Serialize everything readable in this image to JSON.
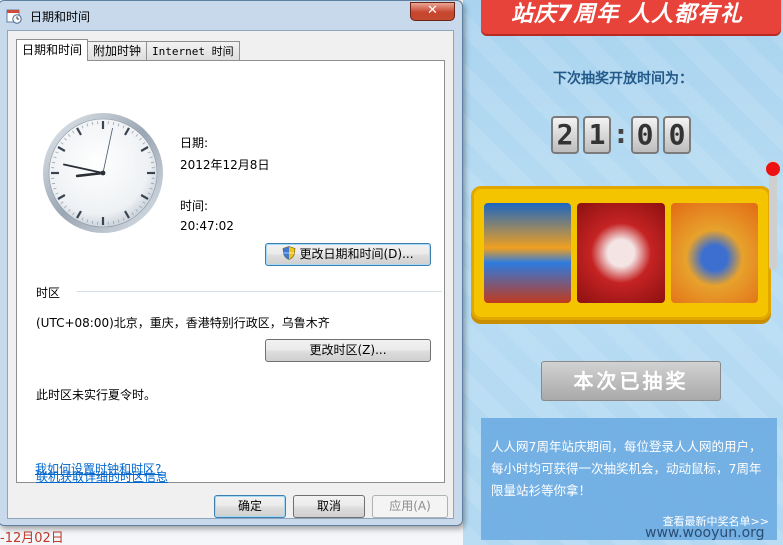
{
  "window": {
    "title": "日期和时间",
    "close_glyph": "✕"
  },
  "tabs": [
    {
      "label": "日期和时间",
      "active": true
    },
    {
      "label": "附加时钟",
      "active": false
    },
    {
      "label": "Internet 时间",
      "active": false
    }
  ],
  "date_section": {
    "date_label": "日期:",
    "date_value": "2012年12月8日",
    "time_label": "时间:",
    "time_value": "20:47:02",
    "change_button": "更改日期和时间(D)..."
  },
  "timezone_section": {
    "heading": "时区",
    "current": "(UTC+08:00)北京，重庆，香港特别行政区，乌鲁木齐",
    "change_button": "更改时区(Z)...",
    "dst_note": "此时区未实行夏令时。"
  },
  "links": {
    "online_info": "联机获取详细的时区信息",
    "how_to": "我如何设置时钟和时区?"
  },
  "footer_buttons": {
    "ok": "确定",
    "cancel": "取消",
    "apply": "应用(A)"
  },
  "clock": {
    "hour": 20,
    "minute": 47,
    "second": 2
  },
  "background_page": {
    "left_date_fragment": "-12月02日",
    "banner": "站庆7周年 人人都有礼",
    "next_draw_title": "下次抽奖开放时间为：",
    "timer_digits": [
      "2",
      "1",
      ":",
      "0",
      "0"
    ],
    "drawn_button": "本次已抽奖",
    "description": "人人网7周年站庆期间，每位登录人人网的用户，每小时均可获得一次抽奖机会，动动鼠标，7周年限量站衫等你拿！",
    "winners_link": "查看最新中奖名单>>",
    "brand": "www.wooyun.org"
  },
  "colors": {
    "accent_link": "#0066cc",
    "banner_red": "#e8433a",
    "slot_yellow": "#f5c400"
  }
}
